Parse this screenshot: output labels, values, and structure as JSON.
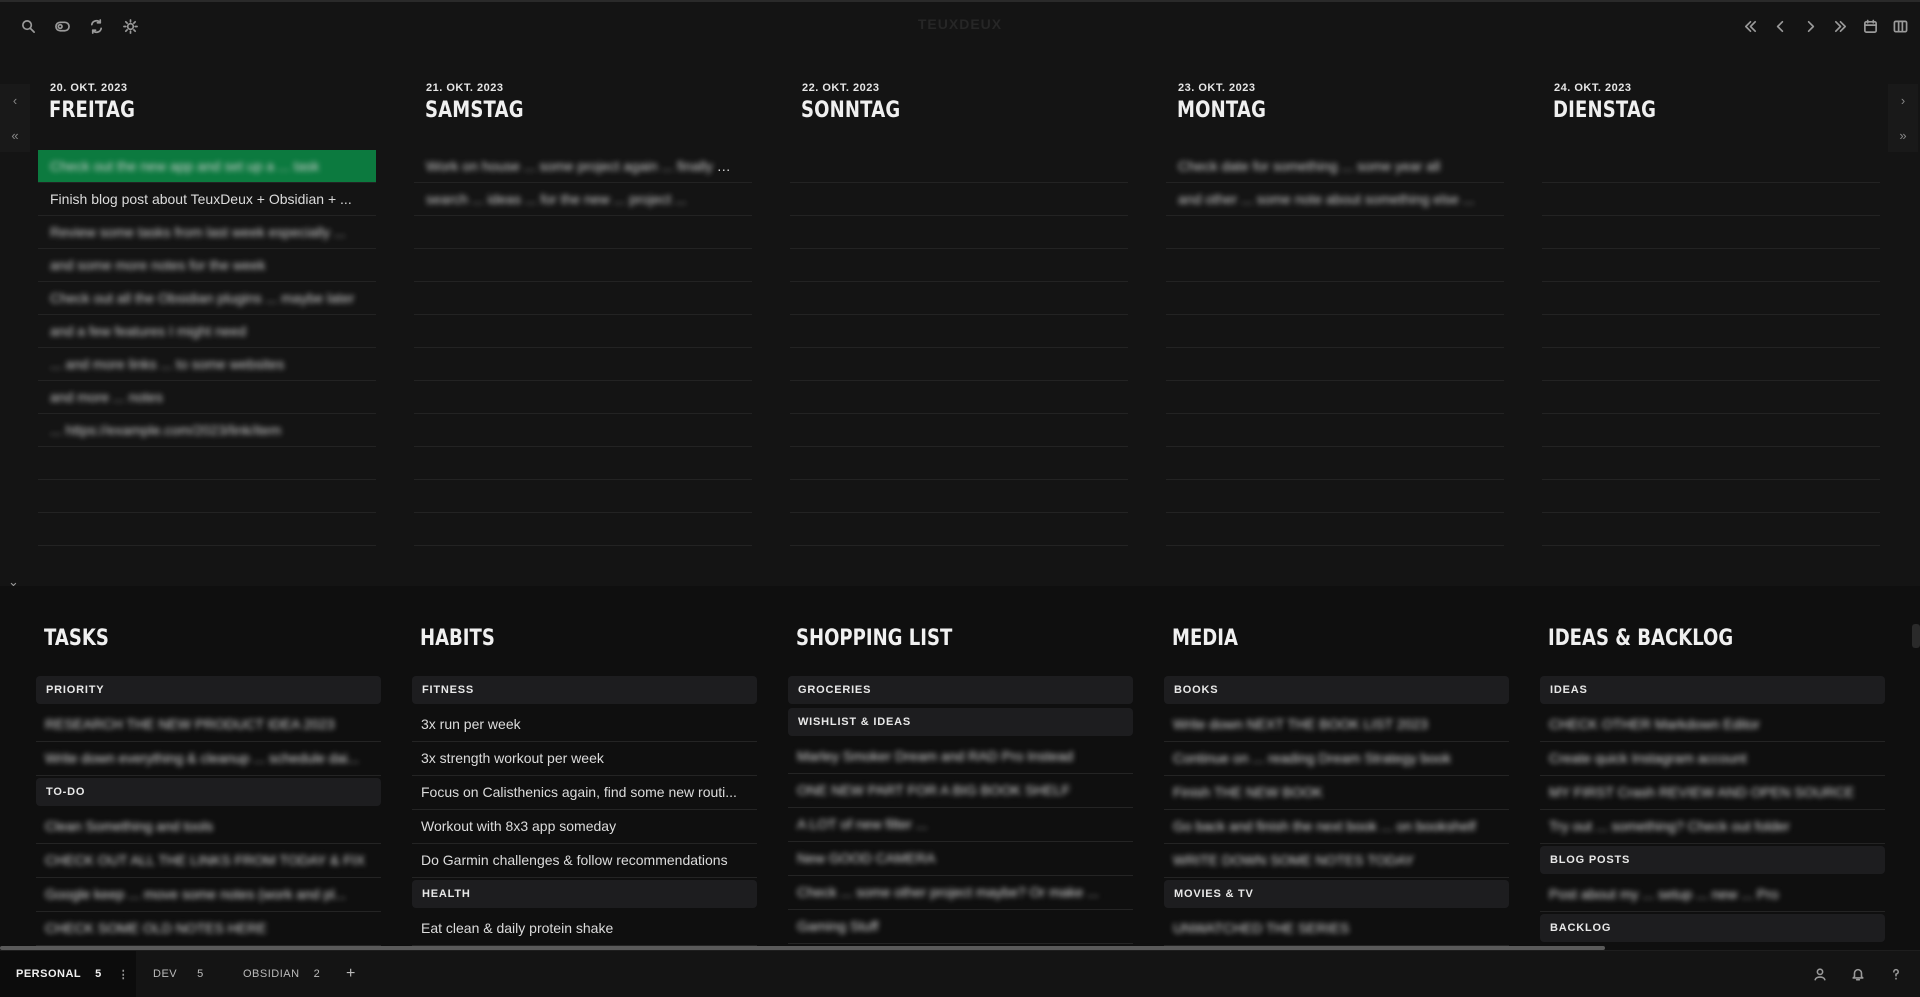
{
  "app_title": "TEUXDEUX",
  "toolbar_left": [
    {
      "name": "search-icon"
    },
    {
      "name": "toggle-icon"
    },
    {
      "name": "sync-icon"
    },
    {
      "name": "theme-icon"
    }
  ],
  "toolbar_right": [
    {
      "name": "jump-back-icon"
    },
    {
      "name": "back-icon"
    },
    {
      "name": "forward-icon"
    },
    {
      "name": "jump-forward-icon"
    },
    {
      "name": "calendar-icon"
    },
    {
      "name": "columns-icon"
    }
  ],
  "days": [
    {
      "date": "20. OKT. 2023",
      "name": "FREITAG",
      "items": [
        {
          "text": "Check out the new app and set up a ... task",
          "blurred": true,
          "active": true
        },
        {
          "text": "Finish blog post about TeuxDeux + Obsidian + ...",
          "blurred": false
        },
        {
          "text": "Review some tasks from last week especially ...",
          "blurred": true
        },
        {
          "text": "and some more notes for the week",
          "blurred": true
        },
        {
          "text": "Check out all the Obsidian plugins ... maybe later",
          "blurred": true
        },
        {
          "text": "and a few features I might need",
          "blurred": true
        },
        {
          "text": "... and more links ... to some websites",
          "blurred": true
        },
        {
          "text": "and more ... notes",
          "blurred": true
        },
        {
          "text": "... https://example.com/2023/link/item",
          "blurred": true
        },
        {
          "text": "",
          "blurred": false
        },
        {
          "text": "",
          "blurred": false
        },
        {
          "text": "",
          "blurred": false
        }
      ]
    },
    {
      "date": "21. OKT. 2023",
      "name": "SAMSTAG",
      "items": [
        {
          "text": "Work on house ... some project again ... finally Do...",
          "blurred": true
        },
        {
          "text": "search ... ideas ... for the new ... project ...",
          "blurred": true
        },
        {
          "text": "",
          "blurred": false
        },
        {
          "text": "",
          "blurred": false
        },
        {
          "text": "",
          "blurred": false
        },
        {
          "text": "",
          "blurred": false
        },
        {
          "text": "",
          "blurred": false
        },
        {
          "text": "",
          "blurred": false
        },
        {
          "text": "",
          "blurred": false
        },
        {
          "text": "",
          "blurred": false
        },
        {
          "text": "",
          "blurred": false
        },
        {
          "text": "",
          "blurred": false
        }
      ]
    },
    {
      "date": "22. OKT. 2023",
      "name": "SONNTAG",
      "items": [
        {
          "text": "",
          "blurred": false
        },
        {
          "text": "",
          "blurred": false
        },
        {
          "text": "",
          "blurred": false
        },
        {
          "text": "",
          "blurred": false
        },
        {
          "text": "",
          "blurred": false
        },
        {
          "text": "",
          "blurred": false
        },
        {
          "text": "",
          "blurred": false
        },
        {
          "text": "",
          "blurred": false
        },
        {
          "text": "",
          "blurred": false
        },
        {
          "text": "",
          "blurred": false
        },
        {
          "text": "",
          "blurred": false
        },
        {
          "text": "",
          "blurred": false
        }
      ]
    },
    {
      "date": "23. OKT. 2023",
      "name": "MONTAG",
      "items": [
        {
          "text": "Check date for something ... some year all",
          "blurred": true
        },
        {
          "text": "and other ... some note about something else ...",
          "blurred": true
        },
        {
          "text": "",
          "blurred": false
        },
        {
          "text": "",
          "blurred": false
        },
        {
          "text": "",
          "blurred": false
        },
        {
          "text": "",
          "blurred": false
        },
        {
          "text": "",
          "blurred": false
        },
        {
          "text": "",
          "blurred": false
        },
        {
          "text": "",
          "blurred": false
        },
        {
          "text": "",
          "blurred": false
        },
        {
          "text": "",
          "blurred": false
        },
        {
          "text": "",
          "blurred": false
        }
      ]
    },
    {
      "date": "24. OKT. 2023",
      "name": "DIENSTAG",
      "items": [
        {
          "text": "",
          "blurred": false
        },
        {
          "text": "",
          "blurred": false
        },
        {
          "text": "",
          "blurred": false
        },
        {
          "text": "",
          "blurred": false
        },
        {
          "text": "",
          "blurred": false
        },
        {
          "text": "",
          "blurred": false
        },
        {
          "text": "",
          "blurred": false
        },
        {
          "text": "",
          "blurred": false
        },
        {
          "text": "",
          "blurred": false
        },
        {
          "text": "",
          "blurred": false
        },
        {
          "text": "",
          "blurred": false
        },
        {
          "text": "",
          "blurred": false
        }
      ]
    }
  ],
  "lists": [
    {
      "title": "TASKS",
      "rows": [
        {
          "type": "section",
          "text": "PRIORITY"
        },
        {
          "type": "item",
          "text": "RESEARCH THE NEW PRODUCT IDEA 2023",
          "blurred": true
        },
        {
          "type": "item",
          "text": "Write down everything & cleanup ... schedule dai...",
          "blurred": true
        },
        {
          "type": "section",
          "text": "TO-DO"
        },
        {
          "type": "item",
          "text": "Clean Something and tools",
          "blurred": true
        },
        {
          "type": "item",
          "text": "CHECK OUT ALL THE LINKS FROM TODAY & FIX",
          "blurred": true
        },
        {
          "type": "item",
          "text": "Google keep ... move some notes (work and pl...",
          "blurred": true
        },
        {
          "type": "item",
          "text": "CHECK SOME OLD NOTES HERE",
          "blurred": true
        }
      ]
    },
    {
      "title": "HABITS",
      "rows": [
        {
          "type": "section",
          "text": "FITNESS"
        },
        {
          "type": "item",
          "text": "3x run per week",
          "blurred": false
        },
        {
          "type": "item",
          "text": "3x strength workout per week",
          "blurred": false
        },
        {
          "type": "item",
          "text": "Focus on Calisthenics again, find some new routi...",
          "blurred": false
        },
        {
          "type": "item",
          "text": "Workout with 8x3 app someday",
          "blurred": false
        },
        {
          "type": "item",
          "text": "Do Garmin challenges & follow recommendations",
          "blurred": false
        },
        {
          "type": "section",
          "text": "HEALTH"
        },
        {
          "type": "item",
          "text": "Eat clean & daily protein shake",
          "blurred": false
        }
      ]
    },
    {
      "title": "SHOPPING LIST",
      "rows": [
        {
          "type": "section",
          "text": "GROCERIES"
        },
        {
          "type": "section",
          "text": "WISHLIST & IDEAS"
        },
        {
          "type": "item",
          "text": "Marley Smoker Dream and RAD Pro Instead",
          "blurred": true
        },
        {
          "type": "item",
          "text": "ONE NEW PART FOR A BIG BOOK SHELF",
          "blurred": true
        },
        {
          "type": "item",
          "text": "A LOT of new filter ...",
          "blurred": true
        },
        {
          "type": "item",
          "text": "New GOOD CAMERA",
          "blurred": true
        },
        {
          "type": "item",
          "text": "Check ... some other project maybe? Or make ...",
          "blurred": true
        },
        {
          "type": "item",
          "text": "Gaming Stuff",
          "blurred": true
        }
      ]
    },
    {
      "title": "MEDIA",
      "rows": [
        {
          "type": "section",
          "text": "BOOKS"
        },
        {
          "type": "item",
          "text": "Write down NEXT THE BOOK LIST 2023",
          "blurred": true
        },
        {
          "type": "item",
          "text": "Continue on ... reading Dream Strategy book",
          "blurred": true
        },
        {
          "type": "item",
          "text": "Finish THE NEW BOOK",
          "blurred": true
        },
        {
          "type": "item",
          "text": "Go back and finish the next book ... on bookshelf",
          "blurred": true
        },
        {
          "type": "item",
          "text": "WRITE DOWN SOME NOTES TODAY",
          "blurred": true
        },
        {
          "type": "section",
          "text": "MOVIES & TV"
        },
        {
          "type": "item",
          "text": "UNWATCHED THE SERIES",
          "blurred": true
        }
      ]
    },
    {
      "title": "IDEAS & BACKLOG",
      "rows": [
        {
          "type": "section",
          "text": "IDEAS"
        },
        {
          "type": "item",
          "text": "CHECK OTHER Markdown Editor",
          "blurred": true
        },
        {
          "type": "item",
          "text": "Create quick Instagram account",
          "blurred": true
        },
        {
          "type": "item",
          "text": "MY FIRST Crash REVIEW AND OPEN SOURCE",
          "blurred": true
        },
        {
          "type": "item",
          "text": "Try out ... something? Check out folder",
          "blurred": true
        },
        {
          "type": "section",
          "text": "BLOG POSTS"
        },
        {
          "type": "item",
          "text": "Post about my ... setup ... new ... Pro",
          "blurred": true
        },
        {
          "type": "section",
          "text": "BACKLOG"
        }
      ]
    }
  ],
  "footer_tabs": [
    {
      "label": "PERSONAL",
      "count": "5",
      "active": true
    },
    {
      "label": "DEV",
      "count": "5",
      "active": false
    },
    {
      "label": "OBSIDIAN",
      "count": "2",
      "active": false
    }
  ],
  "footer_add": "+",
  "footer_more": "⋮",
  "nav": {
    "prev": "‹",
    "jump_prev": "«",
    "next": "›",
    "jump_next": "»",
    "collapse": "⌄"
  },
  "colors": {
    "active_row": "#0c7a3f",
    "background": "#141414"
  }
}
